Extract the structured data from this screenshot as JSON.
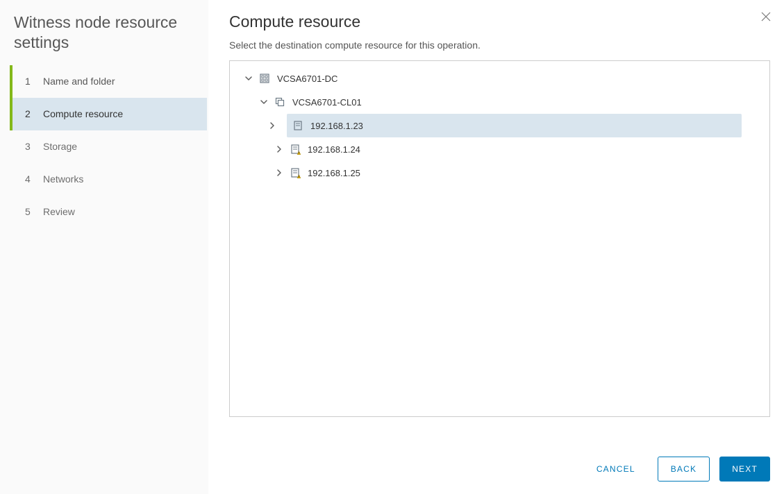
{
  "wizard": {
    "title": "Witness node resource settings",
    "steps": [
      {
        "num": "1",
        "label": "Name and folder",
        "state": "completed"
      },
      {
        "num": "2",
        "label": "Compute resource",
        "state": "active"
      },
      {
        "num": "3",
        "label": "Storage",
        "state": "upcoming"
      },
      {
        "num": "4",
        "label": "Networks",
        "state": "upcoming"
      },
      {
        "num": "5",
        "label": "Review",
        "state": "upcoming"
      }
    ]
  },
  "page": {
    "heading": "Compute resource",
    "subtitle": "Select the destination compute resource for this operation."
  },
  "tree": {
    "nodes": [
      {
        "label": "VCSA6701-DC",
        "icon": "datacenter",
        "depth": 0,
        "caret": "down",
        "selected": false
      },
      {
        "label": "VCSA6701-CL01",
        "icon": "cluster",
        "depth": 1,
        "caret": "down",
        "selected": false
      },
      {
        "label": "192.168.1.23",
        "icon": "host",
        "depth": 2,
        "caret": "right",
        "selected": true
      },
      {
        "label": "192.168.1.24",
        "icon": "host-warn",
        "depth": 2,
        "caret": "right",
        "selected": false
      },
      {
        "label": "192.168.1.25",
        "icon": "host-warn",
        "depth": 2,
        "caret": "right",
        "selected": false
      }
    ]
  },
  "footer": {
    "cancel": "CANCEL",
    "back": "BACK",
    "next": "NEXT"
  }
}
